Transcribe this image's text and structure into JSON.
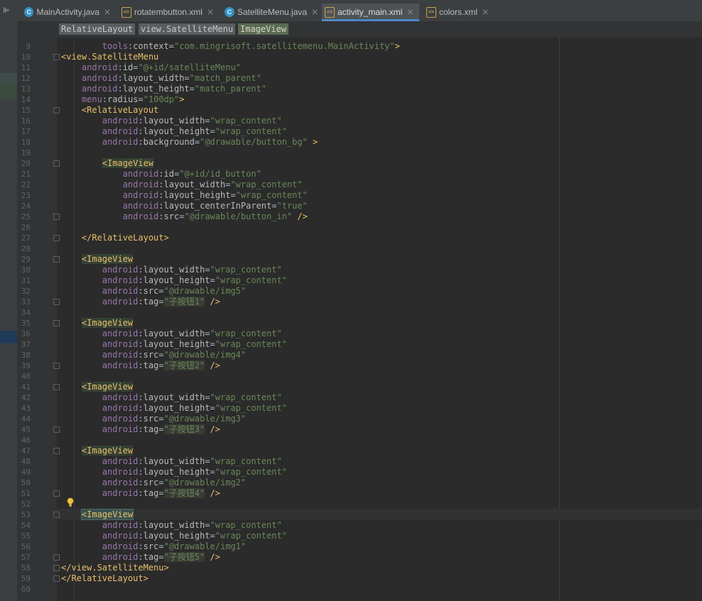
{
  "tabs": [
    {
      "label": "MainActivity.java",
      "type": "java",
      "active": false
    },
    {
      "label": "rotatembutton.xml",
      "type": "xml",
      "active": false
    },
    {
      "label": "SatelliteMenu.java",
      "type": "java",
      "active": false
    },
    {
      "label": "activity_main.xml",
      "type": "xml",
      "active": true
    },
    {
      "label": "colors.xml",
      "type": "xml",
      "active": false
    }
  ],
  "breadcrumbs": [
    "RelativeLayout",
    "view.SatelliteMenu",
    "ImageView"
  ],
  "colors": {
    "background": "#2b2b2b",
    "tag": "#e8bf6a",
    "namespace": "#9876aa",
    "attribute": "#bababa",
    "string": "#6a8759",
    "active_tab_underline": "#4a88c7"
  },
  "icons": {
    "java_tab": "java-class-icon",
    "xml_tab": "xml-file-icon",
    "intention": "lightbulb-icon"
  },
  "caret_line": 53,
  "code_lines": [
    {
      "n": "9",
      "tokens": [
        [
          "",
          "        "
        ],
        [
          "ns",
          "tools"
        ],
        [
          "",
          ":"
        ],
        [
          "attr",
          "context"
        ],
        [
          "",
          "="
        ],
        [
          "val",
          "\"com.mingrisoft.satellitemenu.MainActivity\""
        ],
        [
          "tag",
          ">"
        ]
      ]
    },
    {
      "n": "10",
      "tokens": [
        [
          "tag",
          "<view.SatelliteMenu"
        ]
      ]
    },
    {
      "n": "11",
      "tokens": [
        [
          "",
          "    "
        ],
        [
          "ns",
          "android"
        ],
        [
          "",
          ":"
        ],
        [
          "attr",
          "id"
        ],
        [
          "",
          "="
        ],
        [
          "val",
          "\"@+id/satelliteMenu\""
        ]
      ]
    },
    {
      "n": "12",
      "tokens": [
        [
          "",
          "    "
        ],
        [
          "ns",
          "android"
        ],
        [
          "",
          ":"
        ],
        [
          "attr",
          "layout_width"
        ],
        [
          "",
          "="
        ],
        [
          "val",
          "\"match_parent\""
        ]
      ]
    },
    {
      "n": "13",
      "tokens": [
        [
          "",
          "    "
        ],
        [
          "ns",
          "android"
        ],
        [
          "",
          ":"
        ],
        [
          "attr",
          "layout_height"
        ],
        [
          "",
          "="
        ],
        [
          "val",
          "\"match_parent\""
        ]
      ]
    },
    {
      "n": "14",
      "tokens": [
        [
          "",
          "    "
        ],
        [
          "ns",
          "menu"
        ],
        [
          "",
          ":"
        ],
        [
          "attr",
          "radius"
        ],
        [
          "",
          "="
        ],
        [
          "val",
          "\"100dp\""
        ],
        [
          "tag",
          ">"
        ]
      ]
    },
    {
      "n": "15",
      "tokens": [
        [
          "",
          "    "
        ],
        [
          "tag",
          "<RelativeLayout"
        ]
      ]
    },
    {
      "n": "16",
      "tokens": [
        [
          "",
          "        "
        ],
        [
          "ns",
          "android"
        ],
        [
          "",
          ":"
        ],
        [
          "attr",
          "layout_width"
        ],
        [
          "",
          "="
        ],
        [
          "val",
          "\"wrap_content\""
        ]
      ]
    },
    {
      "n": "17",
      "tokens": [
        [
          "",
          "        "
        ],
        [
          "ns",
          "android"
        ],
        [
          "",
          ":"
        ],
        [
          "attr",
          "layout_height"
        ],
        [
          "",
          "="
        ],
        [
          "val",
          "\"wrap_content\""
        ]
      ]
    },
    {
      "n": "18",
      "tokens": [
        [
          "",
          "        "
        ],
        [
          "ns",
          "android"
        ],
        [
          "",
          ":"
        ],
        [
          "attr",
          "background"
        ],
        [
          "",
          "="
        ],
        [
          "val",
          "\"@drawable/button_bg\""
        ],
        [
          "",
          " "
        ],
        [
          "tag",
          ">"
        ]
      ]
    },
    {
      "n": "19",
      "tokens": []
    },
    {
      "n": "20",
      "tokens": [
        [
          "",
          "        "
        ],
        [
          "tag hl",
          "<ImageView"
        ]
      ]
    },
    {
      "n": "21",
      "tokens": [
        [
          "",
          "            "
        ],
        [
          "ns",
          "android"
        ],
        [
          "",
          ":"
        ],
        [
          "attr",
          "id"
        ],
        [
          "",
          "="
        ],
        [
          "val",
          "\"@+id/id_button\""
        ]
      ]
    },
    {
      "n": "22",
      "tokens": [
        [
          "",
          "            "
        ],
        [
          "ns",
          "android"
        ],
        [
          "",
          ":"
        ],
        [
          "attr",
          "layout_width"
        ],
        [
          "",
          "="
        ],
        [
          "val",
          "\"wrap_content\""
        ]
      ]
    },
    {
      "n": "23",
      "tokens": [
        [
          "",
          "            "
        ],
        [
          "ns",
          "android"
        ],
        [
          "",
          ":"
        ],
        [
          "attr",
          "layout_height"
        ],
        [
          "",
          "="
        ],
        [
          "val",
          "\"wrap_content\""
        ]
      ]
    },
    {
      "n": "24",
      "tokens": [
        [
          "",
          "            "
        ],
        [
          "ns",
          "android"
        ],
        [
          "",
          ":"
        ],
        [
          "attr",
          "layout_centerInParent"
        ],
        [
          "",
          "="
        ],
        [
          "val",
          "\"true\""
        ]
      ]
    },
    {
      "n": "25",
      "tokens": [
        [
          "",
          "            "
        ],
        [
          "ns",
          "android"
        ],
        [
          "",
          ":"
        ],
        [
          "attr",
          "src"
        ],
        [
          "",
          "="
        ],
        [
          "val",
          "\"@drawable/button_in\""
        ],
        [
          "",
          " "
        ],
        [
          "tag",
          "/>"
        ]
      ]
    },
    {
      "n": "26",
      "tokens": []
    },
    {
      "n": "27",
      "tokens": [
        [
          "",
          "    "
        ],
        [
          "tag",
          "</RelativeLayout>"
        ]
      ]
    },
    {
      "n": "28",
      "tokens": []
    },
    {
      "n": "29",
      "tokens": [
        [
          "",
          "    "
        ],
        [
          "tag hl",
          "<ImageView"
        ]
      ]
    },
    {
      "n": "30",
      "tokens": [
        [
          "",
          "        "
        ],
        [
          "ns",
          "android"
        ],
        [
          "",
          ":"
        ],
        [
          "attr",
          "layout_width"
        ],
        [
          "",
          "="
        ],
        [
          "val",
          "\"wrap_content\""
        ]
      ]
    },
    {
      "n": "31",
      "tokens": [
        [
          "",
          "        "
        ],
        [
          "ns",
          "android"
        ],
        [
          "",
          ":"
        ],
        [
          "attr",
          "layout_height"
        ],
        [
          "",
          "="
        ],
        [
          "val",
          "\"wrap_content\""
        ]
      ]
    },
    {
      "n": "32",
      "tokens": [
        [
          "",
          "        "
        ],
        [
          "ns",
          "android"
        ],
        [
          "",
          ":"
        ],
        [
          "attr",
          "src"
        ],
        [
          "",
          "="
        ],
        [
          "val",
          "\"@drawable/img5\""
        ]
      ]
    },
    {
      "n": "33",
      "tokens": [
        [
          "",
          "        "
        ],
        [
          "ns",
          "android"
        ],
        [
          "",
          ":"
        ],
        [
          "attr",
          "tag"
        ],
        [
          "",
          "="
        ],
        [
          "han",
          "\"子按钮1\""
        ],
        [
          "",
          " "
        ],
        [
          "tag",
          "/>"
        ]
      ]
    },
    {
      "n": "34",
      "tokens": []
    },
    {
      "n": "35",
      "tokens": [
        [
          "",
          "    "
        ],
        [
          "tag hl",
          "<ImageView"
        ]
      ]
    },
    {
      "n": "36",
      "tokens": [
        [
          "",
          "        "
        ],
        [
          "ns",
          "android"
        ],
        [
          "",
          ":"
        ],
        [
          "attr",
          "layout_width"
        ],
        [
          "",
          "="
        ],
        [
          "val",
          "\"wrap_content\""
        ]
      ]
    },
    {
      "n": "37",
      "tokens": [
        [
          "",
          "        "
        ],
        [
          "ns",
          "android"
        ],
        [
          "",
          ":"
        ],
        [
          "attr",
          "layout_height"
        ],
        [
          "",
          "="
        ],
        [
          "val",
          "\"wrap_content\""
        ]
      ]
    },
    {
      "n": "38",
      "tokens": [
        [
          "",
          "        "
        ],
        [
          "ns",
          "android"
        ],
        [
          "",
          ":"
        ],
        [
          "attr",
          "src"
        ],
        [
          "",
          "="
        ],
        [
          "val",
          "\"@drawable/img4\""
        ]
      ]
    },
    {
      "n": "39",
      "tokens": [
        [
          "",
          "        "
        ],
        [
          "ns",
          "android"
        ],
        [
          "",
          ":"
        ],
        [
          "attr",
          "tag"
        ],
        [
          "",
          "="
        ],
        [
          "han",
          "\"子按钮2\""
        ],
        [
          "",
          " "
        ],
        [
          "tag",
          "/>"
        ]
      ]
    },
    {
      "n": "40",
      "tokens": []
    },
    {
      "n": "41",
      "tokens": [
        [
          "",
          "    "
        ],
        [
          "tag hl",
          "<ImageView"
        ]
      ]
    },
    {
      "n": "42",
      "tokens": [
        [
          "",
          "        "
        ],
        [
          "ns",
          "android"
        ],
        [
          "",
          ":"
        ],
        [
          "attr",
          "layout_width"
        ],
        [
          "",
          "="
        ],
        [
          "val",
          "\"wrap_content\""
        ]
      ]
    },
    {
      "n": "43",
      "tokens": [
        [
          "",
          "        "
        ],
        [
          "ns",
          "android"
        ],
        [
          "",
          ":"
        ],
        [
          "attr",
          "layout_height"
        ],
        [
          "",
          "="
        ],
        [
          "val",
          "\"wrap_content\""
        ]
      ]
    },
    {
      "n": "44",
      "tokens": [
        [
          "",
          "        "
        ],
        [
          "ns",
          "android"
        ],
        [
          "",
          ":"
        ],
        [
          "attr",
          "src"
        ],
        [
          "",
          "="
        ],
        [
          "val",
          "\"@drawable/img3\""
        ]
      ]
    },
    {
      "n": "45",
      "tokens": [
        [
          "",
          "        "
        ],
        [
          "ns",
          "android"
        ],
        [
          "",
          ":"
        ],
        [
          "attr",
          "tag"
        ],
        [
          "",
          "="
        ],
        [
          "han",
          "\"子按钮3\""
        ],
        [
          "",
          " "
        ],
        [
          "tag",
          "/>"
        ]
      ]
    },
    {
      "n": "46",
      "tokens": []
    },
    {
      "n": "47",
      "tokens": [
        [
          "",
          "    "
        ],
        [
          "tag hl",
          "<ImageView"
        ]
      ]
    },
    {
      "n": "48",
      "tokens": [
        [
          "",
          "        "
        ],
        [
          "ns",
          "android"
        ],
        [
          "",
          ":"
        ],
        [
          "attr",
          "layout_width"
        ],
        [
          "",
          "="
        ],
        [
          "val",
          "\"wrap_content\""
        ]
      ]
    },
    {
      "n": "49",
      "tokens": [
        [
          "",
          "        "
        ],
        [
          "ns",
          "android"
        ],
        [
          "",
          ":"
        ],
        [
          "attr",
          "layout_height"
        ],
        [
          "",
          "="
        ],
        [
          "val",
          "\"wrap_content\""
        ]
      ]
    },
    {
      "n": "50",
      "tokens": [
        [
          "",
          "        "
        ],
        [
          "ns",
          "android"
        ],
        [
          "",
          ":"
        ],
        [
          "attr",
          "src"
        ],
        [
          "",
          "="
        ],
        [
          "val",
          "\"@drawable/img2\""
        ]
      ]
    },
    {
      "n": "51",
      "tokens": [
        [
          "",
          "        "
        ],
        [
          "ns",
          "android"
        ],
        [
          "",
          ":"
        ],
        [
          "attr",
          "tag"
        ],
        [
          "",
          "="
        ],
        [
          "han",
          "\"子按钮4\""
        ],
        [
          "",
          " "
        ],
        [
          "tag",
          "/>"
        ]
      ]
    },
    {
      "n": "52",
      "tokens": []
    },
    {
      "n": "53",
      "tokens": [
        [
          "",
          "    "
        ],
        [
          "tag mh",
          "<ImageView"
        ]
      ]
    },
    {
      "n": "54",
      "tokens": [
        [
          "",
          "        "
        ],
        [
          "ns",
          "android"
        ],
        [
          "",
          ":"
        ],
        [
          "attr",
          "layout_width"
        ],
        [
          "",
          "="
        ],
        [
          "val",
          "\"wrap_content\""
        ]
      ]
    },
    {
      "n": "55",
      "tokens": [
        [
          "",
          "        "
        ],
        [
          "ns",
          "android"
        ],
        [
          "",
          ":"
        ],
        [
          "attr",
          "layout_height"
        ],
        [
          "",
          "="
        ],
        [
          "val",
          "\"wrap_content\""
        ]
      ]
    },
    {
      "n": "56",
      "tokens": [
        [
          "",
          "        "
        ],
        [
          "ns",
          "android"
        ],
        [
          "",
          ":"
        ],
        [
          "attr",
          "src"
        ],
        [
          "",
          "="
        ],
        [
          "val",
          "\"@drawable/img1\""
        ]
      ]
    },
    {
      "n": "57",
      "tokens": [
        [
          "",
          "        "
        ],
        [
          "ns",
          "android"
        ],
        [
          "",
          ":"
        ],
        [
          "attr",
          "tag"
        ],
        [
          "",
          "="
        ],
        [
          "han",
          "\"子按钮5\""
        ],
        [
          "",
          " "
        ],
        [
          "tag",
          "/>"
        ]
      ]
    },
    {
      "n": "58",
      "tokens": [
        [
          "tag",
          "</view.SatelliteMenu>"
        ]
      ]
    },
    {
      "n": "59",
      "tokens": [
        [
          "tag",
          "</RelativeLayout>"
        ]
      ]
    },
    {
      "n": "60",
      "tokens": []
    }
  ]
}
